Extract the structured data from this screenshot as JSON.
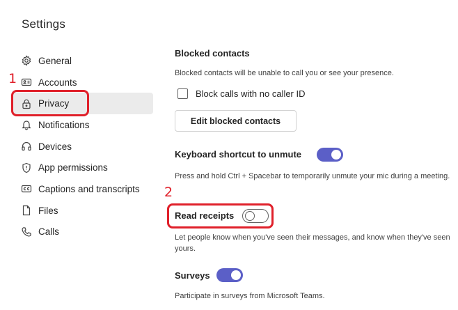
{
  "page": {
    "title": "Settings"
  },
  "sidebar": {
    "items": [
      {
        "label": "General",
        "icon": "gear-icon"
      },
      {
        "label": "Accounts",
        "icon": "id-card-icon"
      },
      {
        "label": "Privacy",
        "icon": "lock-icon",
        "selected": true
      },
      {
        "label": "Notifications",
        "icon": "bell-icon"
      },
      {
        "label": "Devices",
        "icon": "headset-icon"
      },
      {
        "label": "App permissions",
        "icon": "shield-icon"
      },
      {
        "label": "Captions and transcripts",
        "icon": "cc-icon"
      },
      {
        "label": "Files",
        "icon": "file-icon"
      },
      {
        "label": "Calls",
        "icon": "phone-icon"
      }
    ]
  },
  "blocked": {
    "title": "Blocked contacts",
    "description": "Blocked contacts will be unable to call you or see your presence.",
    "checkbox_label": "Block calls with no caller ID",
    "checkbox_checked": false,
    "button_label": "Edit blocked contacts"
  },
  "keyboard": {
    "title": "Keyboard shortcut to unmute",
    "description": "Press and hold Ctrl + Spacebar to temporarily unmute your mic during a meeting.",
    "toggle_on": true
  },
  "receipts": {
    "title": "Read receipts",
    "description": "Let people know when you've seen their messages, and know when they've seen yours.",
    "toggle_on": false
  },
  "surveys": {
    "title": "Surveys",
    "description": "Participate in surveys from Microsoft Teams.",
    "toggle_on": true
  },
  "annotations": {
    "one": "1",
    "two": "2",
    "color": "#e0202a"
  },
  "colors": {
    "accent": "#5b5fc7",
    "selected_bg": "#ebebeb"
  }
}
